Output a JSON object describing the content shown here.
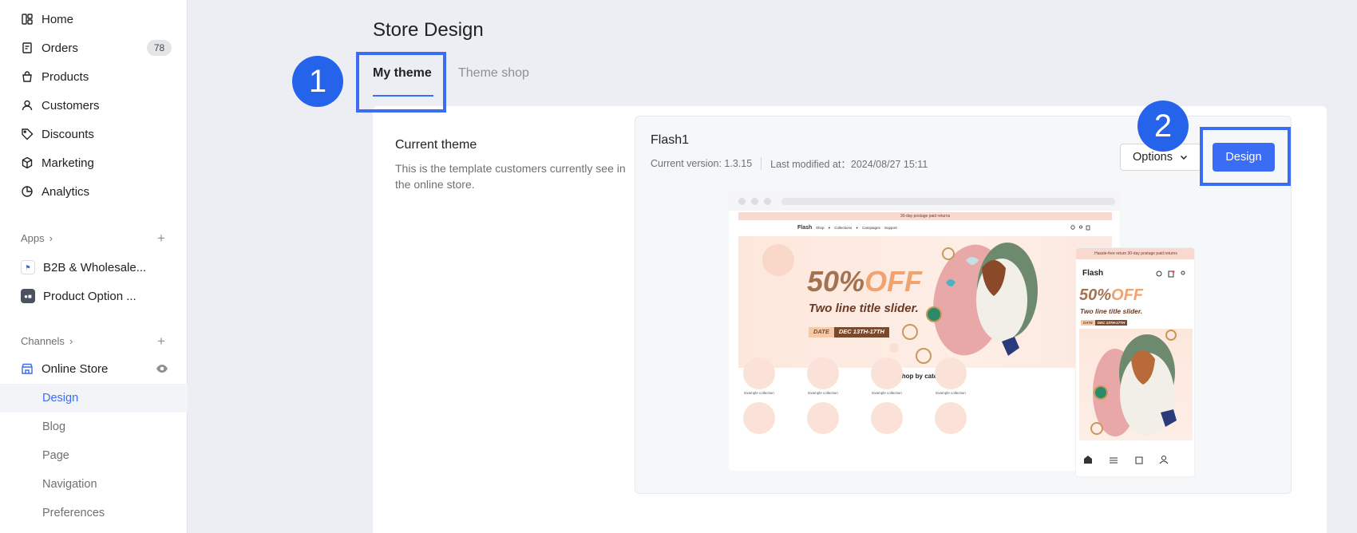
{
  "sidebar": {
    "nav": [
      {
        "label": "Home",
        "icon": "home-icon"
      },
      {
        "label": "Orders",
        "icon": "orders-icon",
        "badge": "78"
      },
      {
        "label": "Products",
        "icon": "products-icon"
      },
      {
        "label": "Customers",
        "icon": "customers-icon"
      },
      {
        "label": "Discounts",
        "icon": "discounts-icon"
      },
      {
        "label": "Marketing",
        "icon": "marketing-icon"
      },
      {
        "label": "Analytics",
        "icon": "analytics-icon"
      }
    ],
    "apps_heading": "Apps",
    "apps": [
      {
        "label": "B2B & Wholesale..."
      },
      {
        "label": "Product Option ..."
      }
    ],
    "channels_heading": "Channels",
    "online_store": "Online Store",
    "sub_items": [
      {
        "label": "Design",
        "active": true
      },
      {
        "label": "Blog"
      },
      {
        "label": "Page"
      },
      {
        "label": "Navigation"
      },
      {
        "label": "Preferences"
      }
    ]
  },
  "main": {
    "page_title": "Store Design",
    "tabs": [
      {
        "label": "My theme",
        "active": true
      },
      {
        "label": "Theme shop"
      }
    ],
    "current_theme": {
      "title": "Current theme",
      "description": "This is the template customers currently see in the online store."
    },
    "theme": {
      "name": "Flash1",
      "version_text": "Current version: 1.3.15",
      "modified_text": "Last modified at：2024/08/27 15:11",
      "options_label": "Options",
      "design_label": "Design"
    },
    "preview": {
      "announcement": "30-day postage paid returns",
      "mobile_announcement": "Hassle-free return 30-day postage paid returns",
      "logo": "Flash",
      "nav_links": "Shop ▾ Collections ▾ Campaigns Support",
      "hero_percent": "50%",
      "hero_off": "OFF",
      "hero_subtitle": "Two line title slider.",
      "hero_date_label": "DATE",
      "hero_date_value": "DEC 13TH-17TH",
      "shop_by_category": "Shop by category",
      "category_label": "Example collection"
    },
    "steps": [
      "1",
      "2"
    ]
  },
  "colors": {
    "accent": "#3a6cf4",
    "step_marker": "#2563eb",
    "background": "#eceef3"
  }
}
